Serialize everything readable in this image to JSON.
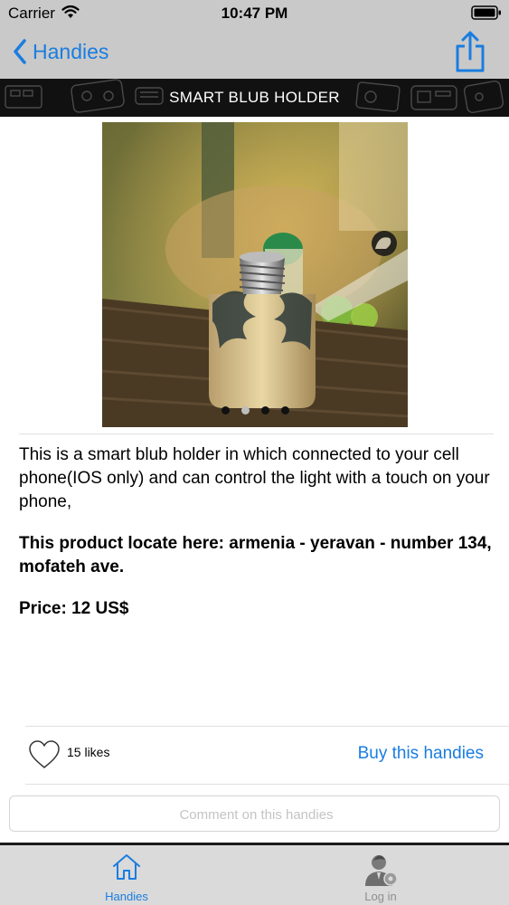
{
  "status_bar": {
    "carrier": "Carrier",
    "time": "10:47 PM"
  },
  "nav": {
    "back_label": "Handies",
    "back_icon": "chevron-left-icon",
    "share_icon": "share-icon"
  },
  "product": {
    "title": "SMART BLUB HOLDER",
    "description": "This is a smart blub holder in which connected to your cell phone(IOS only) and can control the light with a touch on your phone,",
    "location": "This product locate here: armenia - yeravan - number 134, mofateh ave.",
    "price": "Price: 12 US$",
    "image_count": 4,
    "active_image": 1
  },
  "social": {
    "likes": "15 likes",
    "buy_label": "Buy this handies"
  },
  "comment": {
    "placeholder": "Comment on this handies"
  },
  "tabs": [
    {
      "label": "Handies",
      "icon": "home-icon",
      "active": true
    },
    {
      "label": "Log in",
      "icon": "user-icon",
      "active": false
    }
  ],
  "colors": {
    "accent": "#1a7de0",
    "bar_background": "#c9c9c9",
    "tab_background": "#dadada"
  }
}
